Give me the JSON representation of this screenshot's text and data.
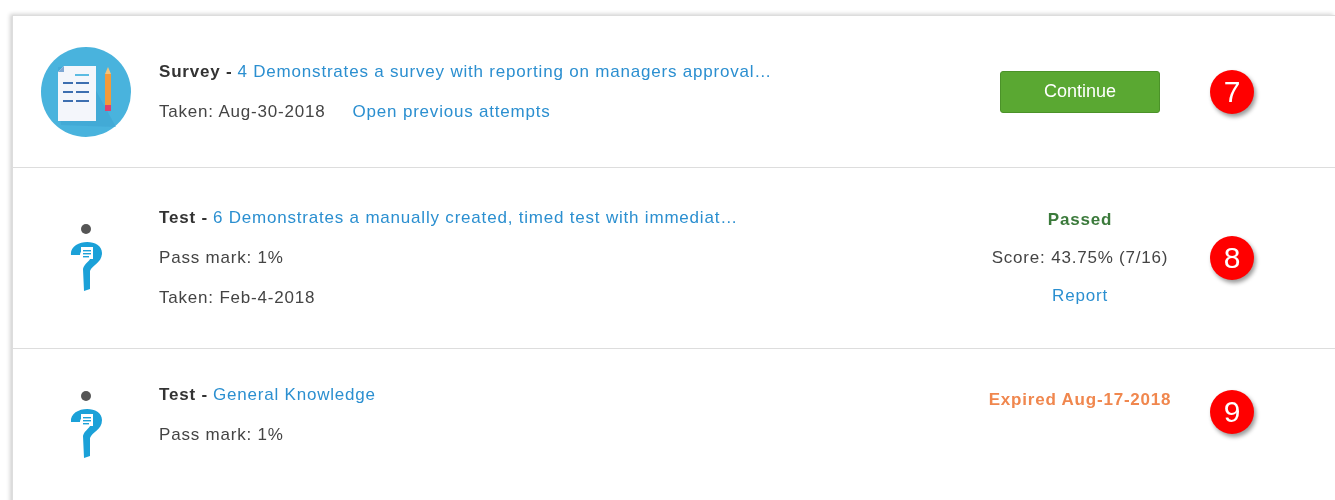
{
  "items": [
    {
      "kind": "survey",
      "type": "Survey -",
      "title": "4 Demonstrates a survey with reporting on managers approval…",
      "lines": [
        [
          {
            "kind": "plain",
            "text": "Taken: Aug-30-2018"
          },
          {
            "kind": "link",
            "text": "Open previous attempts"
          }
        ]
      ],
      "status": {
        "kind": "button",
        "label": "Continue"
      },
      "badge": "7"
    },
    {
      "kind": "test",
      "type": "Test -",
      "title": "6 Demonstrates a manually created, timed test with immediat…",
      "lines": [
        [
          {
            "kind": "plain",
            "text": "Pass mark: 1%"
          }
        ],
        [
          {
            "kind": "plain",
            "text": "Taken: Feb-4-2018"
          }
        ]
      ],
      "status": {
        "kind": "passed",
        "label": "Passed",
        "score": "Score: 43.75% (7/16)",
        "link": "Report"
      },
      "badge": "8"
    },
    {
      "kind": "test",
      "type": "Test -",
      "title": "General Knowledge",
      "lines": [
        [
          {
            "kind": "plain",
            "text": "Pass mark: 1%"
          }
        ]
      ],
      "status": {
        "kind": "expired",
        "label": "Expired Aug-17-2018"
      },
      "badge": "9"
    }
  ]
}
